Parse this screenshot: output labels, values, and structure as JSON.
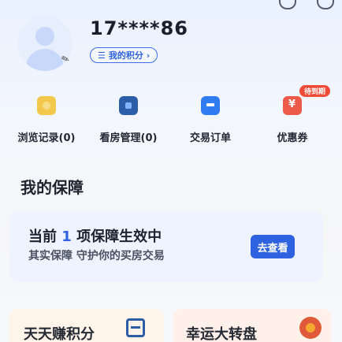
{
  "profile": {
    "username": "17****86",
    "points_label": "我的积分 ›",
    "points_icon": "menu-icon",
    "edit_glyph": "✎"
  },
  "quick_entries": [
    {
      "label": "浏览记录(0)",
      "icon": "history-icon"
    },
    {
      "label": "看房管理(0)",
      "icon": "house-icon"
    },
    {
      "label": "交易订单",
      "icon": "order-icon"
    },
    {
      "label": "优惠券",
      "icon": "coupon-icon",
      "badge": "待到期"
    }
  ],
  "my_insurance": {
    "title": "我的保障",
    "card_title_prefix": "当前",
    "card_count": "1",
    "card_title_suffix": "项保障生效中",
    "card_subtitle": "其实保障 守护你的买房交易",
    "button_label": "去查看"
  },
  "banners": [
    {
      "label": "天天赚积分",
      "icon": "wallet-icon"
    },
    {
      "label": "幸运大转盘",
      "icon": "wheel-icon"
    }
  ],
  "colors": {
    "accent": "#2f62e0",
    "badge_red": "#f14a36",
    "card_bg": "#eef3ff"
  }
}
